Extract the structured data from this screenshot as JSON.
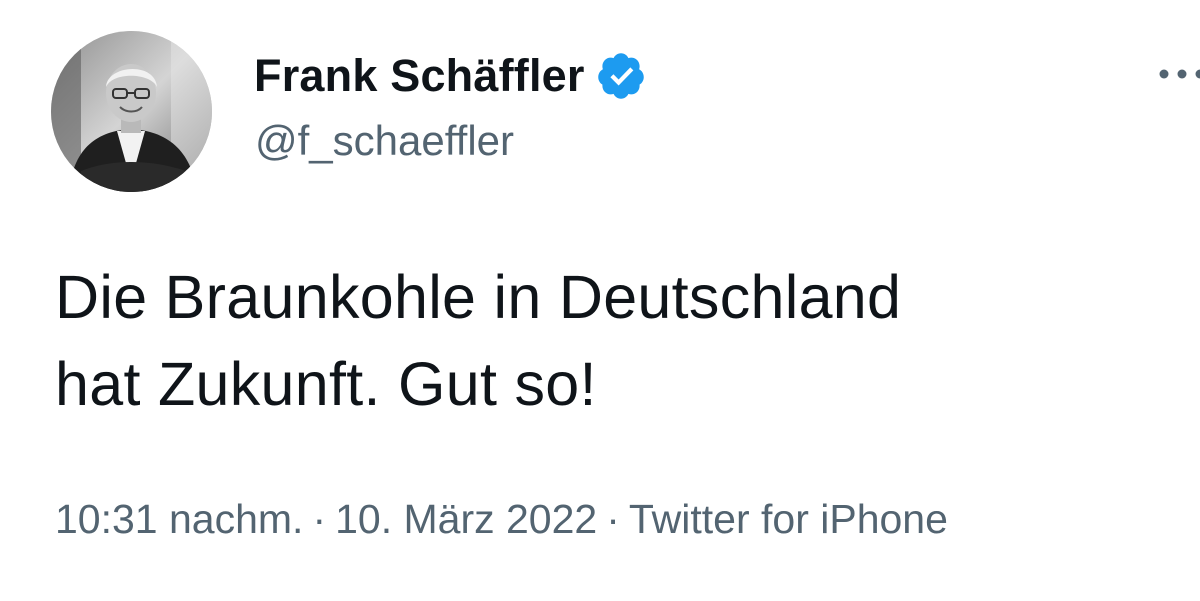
{
  "author": {
    "display_name": "Frank Schäffler",
    "handle": "@f_schaeffler",
    "verified": true,
    "verified_color": "#1d9bf0"
  },
  "tweet": {
    "text_lines": [
      "Die Braunkohle in Deutschland",
      "hat Zukunft. Gut so!"
    ],
    "time": "10:31 nachm.",
    "date": "10. März 2022",
    "source": "Twitter for iPhone",
    "separator": "·"
  },
  "icons": {
    "avatar": "avatar-photo",
    "verified": "verified-badge-icon",
    "more": "more-options-icon"
  },
  "colors": {
    "text": "#0f1419",
    "secondary_text": "#536471",
    "background": "#ffffff"
  }
}
